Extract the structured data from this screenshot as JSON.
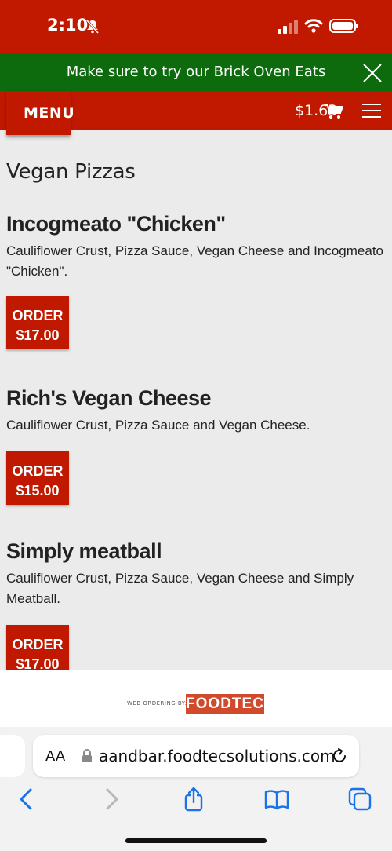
{
  "status_bar": {
    "time": "2:10"
  },
  "promo": {
    "text": "Make sure to try our Brick Oven Eats"
  },
  "nav": {
    "menu_label": "MENU",
    "cart_total": "$1.63"
  },
  "section": {
    "title": "Vegan Pizzas"
  },
  "items": [
    {
      "name": "Incogmeato \"Chicken\"",
      "description": "Cauliflower Crust, Pizza Sauce, Vegan Cheese and Incogmeato \"Chicken\".",
      "order_label": "ORDER",
      "price": "$17.00"
    },
    {
      "name": "Rich's Vegan Cheese",
      "description": "Cauliflower Crust, Pizza Sauce and Vegan Cheese.",
      "order_label": "ORDER",
      "price": "$15.00"
    },
    {
      "name": "Simply meatball",
      "description": "Cauliflower Crust, Pizza Sauce, Vegan Cheese and Simply Meatball.",
      "order_label": "ORDER",
      "price": "$17.00"
    }
  ],
  "footer": {
    "label": "WEB ORDERING BY:",
    "brand": "FOODTEC"
  },
  "browser": {
    "aa_label": "AA",
    "url": "aandbar.foodtecsolutions.com"
  },
  "colors": {
    "brand_red": "#c01900",
    "promo_green": "#0d6b0d",
    "ios_blue": "#1a73e8"
  }
}
